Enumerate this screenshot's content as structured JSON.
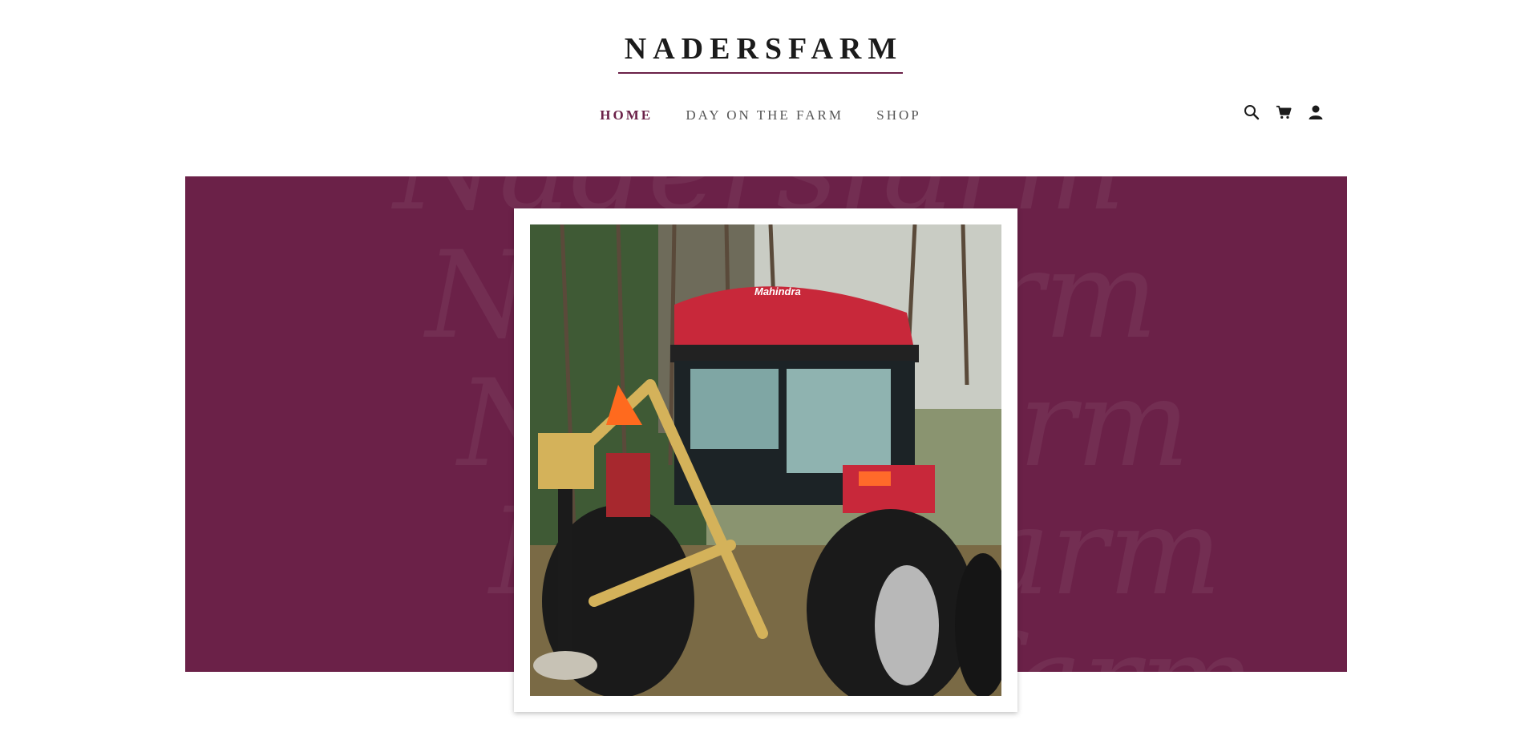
{
  "brand": {
    "name": "NADERSFARM",
    "accent_color": "#6b2148",
    "watermark_text": "Nadersfarm"
  },
  "nav": {
    "items": [
      {
        "label": "HOME",
        "active": true
      },
      {
        "label": "DAY ON THE FARM",
        "active": false
      },
      {
        "label": "SHOP",
        "active": false
      }
    ]
  },
  "header_icons": [
    "search-icon",
    "cart-icon",
    "account-icon"
  ],
  "hero": {
    "background_color": "#6b2148",
    "photo": {
      "subject": "tractor-with-post-hole-digger",
      "tractor_brand_label": "Mahindra"
    }
  }
}
